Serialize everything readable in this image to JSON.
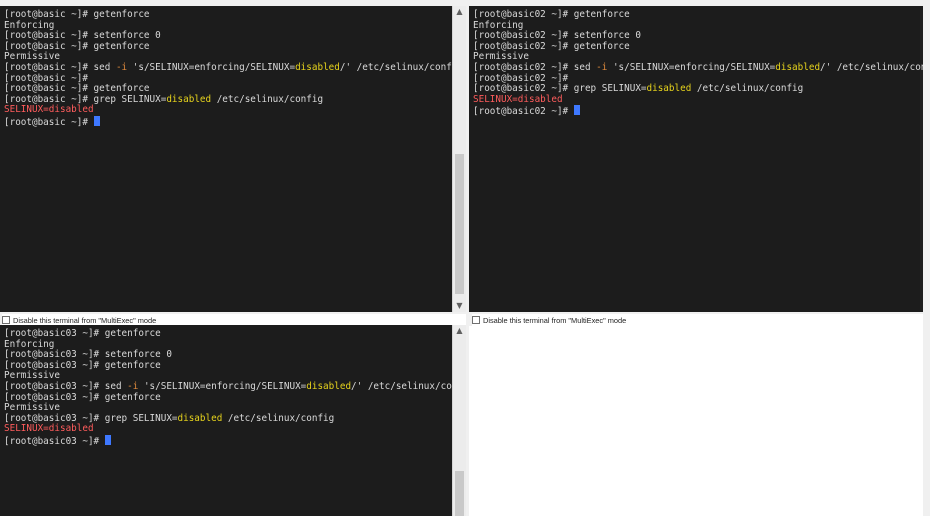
{
  "multiexec_label": "Disable this terminal from \"MultiExec\" mode",
  "scroll_icons": {
    "up": "chevron-up-icon",
    "down": "chevron-down-icon"
  },
  "colors": {
    "terminal_bg": "#1c1c1c",
    "text": "#d9d9d9",
    "keyword": "#e6d31c",
    "error": "#ff5c5c",
    "cursor": "#3e78ff"
  },
  "terminals": [
    {
      "host": "basic",
      "lines": [
        {
          "t": "[root@basic ~]# getenforce"
        },
        {
          "t": "Enforcing"
        },
        {
          "t": "[root@basic ~]# setenforce 0"
        },
        {
          "t": "[root@basic ~]# getenforce"
        },
        {
          "t": "Permissive"
        },
        {
          "pre": "[root@basic ~]# sed ",
          "flag": "-i",
          "mid": " 's/SELINUX=enforcing/SELINUX=",
          "hl": "disabled",
          "post": "/' /etc/selinux/config"
        },
        {
          "t": "[root@basic ~]#"
        },
        {
          "t": "[root@basic ~]# getenforce"
        },
        {
          "pre": "[root@basic ~]# grep SELINUX=",
          "hl": "disabled",
          "post": " /etc/selinux/config"
        },
        {
          "red": "SELINUX=disabled"
        },
        {
          "t": "[root@basic ~]# ",
          "cursor": true
        }
      ]
    },
    {
      "host": "basic02",
      "lines": [
        {
          "t": "[root@basic02 ~]# getenforce"
        },
        {
          "t": "Enforcing"
        },
        {
          "t": "[root@basic02 ~]# setenforce 0"
        },
        {
          "t": "[root@basic02 ~]# getenforce"
        },
        {
          "t": "Permissive"
        },
        {
          "pre": "[root@basic02 ~]# sed ",
          "flag": "-i",
          "mid": " 's/SELINUX=enforcing/SELINUX=",
          "hl": "disabled",
          "post": "/' /etc/selinux/config"
        },
        {
          "t": "[root@basic02 ~]#"
        },
        {
          "pre": "[root@basic02 ~]# grep SELINUX=",
          "hl": "disabled",
          "post": " /etc/selinux/config"
        },
        {
          "red": "SELINUX=disabled"
        },
        {
          "t": "[root@basic02 ~]# ",
          "cursor": true
        }
      ]
    },
    {
      "host": "basic03",
      "lines": [
        {
          "t": "[root@basic03 ~]# getenforce"
        },
        {
          "t": "Enforcing"
        },
        {
          "t": "[root@basic03 ~]# setenforce 0"
        },
        {
          "t": "[root@basic03 ~]# getenforce"
        },
        {
          "t": "Permissive"
        },
        {
          "pre": "[root@basic03 ~]# sed ",
          "flag": "-i",
          "mid": " 's/SELINUX=enforcing/SELINUX=",
          "hl": "disabled",
          "post": "/' /etc/selinux/config"
        },
        {
          "t": "[root@basic03 ~]# getenforce"
        },
        {
          "t": "Permissive"
        },
        {
          "pre": "[root@basic03 ~]# grep SELINUX=",
          "hl": "disabled",
          "post": " /etc/selinux/config"
        },
        {
          "red": "SELINUX=disabled"
        },
        {
          "t": "[root@basic03 ~]# ",
          "cursor": true
        }
      ]
    }
  ]
}
